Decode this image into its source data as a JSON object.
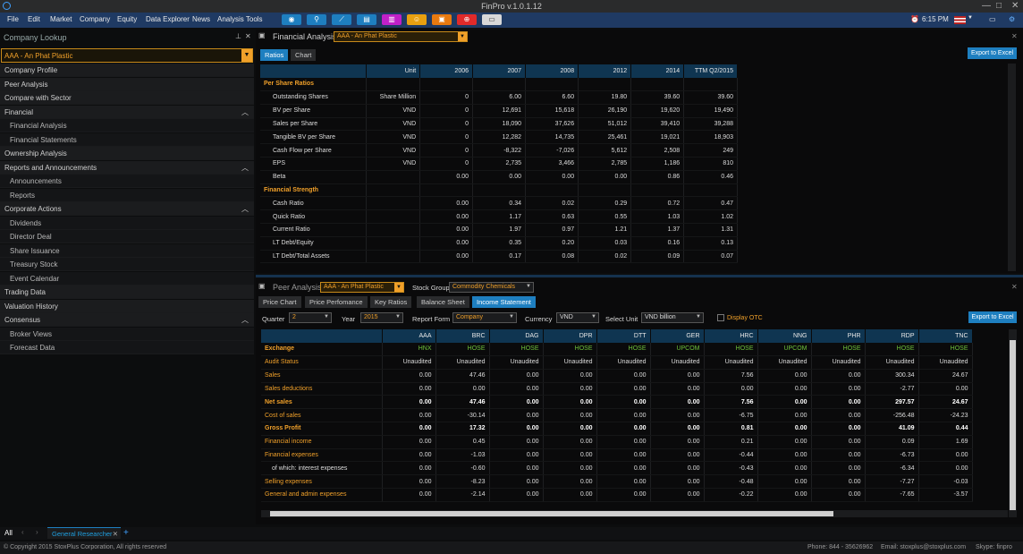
{
  "app": {
    "title": "FinPro v.1.0.1.12",
    "time": "6:15 PM"
  },
  "menu": [
    "File",
    "Edit",
    "Market",
    "Company",
    "Equity",
    "Data Explorer",
    "News",
    "Analysis Tools"
  ],
  "toolbar_colors": [
    "#1e7fc0",
    "#1e7fc0",
    "#1e7fc0",
    "#1e7fc0",
    "#c020c8",
    "#e8a010",
    "#e87a10",
    "#e02a2a",
    "#d8d8d8"
  ],
  "lookup": {
    "title": "Company Lookup",
    "selected": "AAA - An Phat Plastic"
  },
  "nav": [
    {
      "label": "Company Profile",
      "sub": false
    },
    {
      "label": "Peer Analysis",
      "sub": false
    },
    {
      "label": "Compare with Sector",
      "sub": false
    },
    {
      "label": "Financial",
      "sub": false,
      "exp": true
    },
    {
      "label": "Financial Analysis",
      "sub": true
    },
    {
      "label": "Financial Statements",
      "sub": true
    },
    {
      "label": "Ownership Analysis",
      "sub": false
    },
    {
      "label": "Reports and Announcements",
      "sub": false,
      "exp": true
    },
    {
      "label": "Announcements",
      "sub": true
    },
    {
      "label": "Reports",
      "sub": true
    },
    {
      "label": "Corporate Actions",
      "sub": false,
      "exp": true
    },
    {
      "label": "Dividends",
      "sub": true
    },
    {
      "label": "Director Deal",
      "sub": true
    },
    {
      "label": "Share Issuance",
      "sub": true
    },
    {
      "label": "Treasury Stock",
      "sub": true
    },
    {
      "label": "Event Calendar",
      "sub": true
    },
    {
      "label": "Trading Data",
      "sub": false
    },
    {
      "label": "Valuation History",
      "sub": false
    },
    {
      "label": "Consensus",
      "sub": false,
      "exp": true
    },
    {
      "label": "Broker Views",
      "sub": true
    },
    {
      "label": "Forecast Data",
      "sub": true
    }
  ],
  "fa": {
    "title": "Financial Analysis",
    "company": "AAA - An Phat Plastic",
    "tabs": [
      "Ratios",
      "Chart"
    ],
    "export": "Export to Excel",
    "headers": [
      "",
      "Unit",
      "2006",
      "2007",
      "2008",
      "2012",
      "2014",
      "TTM Q2/2015"
    ],
    "rows": [
      {
        "sec": true,
        "c": [
          "Per Share Ratios",
          "",
          "",
          "",
          "",
          "",
          "",
          ""
        ]
      },
      {
        "c": [
          "Outstanding Shares",
          "Share Million",
          "0",
          "6.00",
          "6.60",
          "19.80",
          "39.60",
          "39.60"
        ]
      },
      {
        "c": [
          "BV per Share",
          "VND",
          "0",
          "12,691",
          "15,618",
          "26,190",
          "19,620",
          "19,490"
        ]
      },
      {
        "c": [
          "Sales per Share",
          "VND",
          "0",
          "18,090",
          "37,626",
          "51,012",
          "39,410",
          "39,288"
        ]
      },
      {
        "c": [
          "Tangible BV per Share",
          "VND",
          "0",
          "12,282",
          "14,735",
          "25,461",
          "19,021",
          "18,903"
        ]
      },
      {
        "c": [
          "Cash Flow per Share",
          "VND",
          "0",
          "-8,322",
          "-7,026",
          "5,612",
          "2,508",
          "249"
        ]
      },
      {
        "c": [
          "EPS",
          "VND",
          "0",
          "2,735",
          "3,466",
          "2,785",
          "1,186",
          "810"
        ]
      },
      {
        "c": [
          "Beta",
          "",
          "0.00",
          "0.00",
          "0.00",
          "0.00",
          "0.86",
          "0.46"
        ]
      },
      {
        "sec": true,
        "c": [
          "Financial Strength",
          "",
          "",
          "",
          "",
          "",
          "",
          ""
        ]
      },
      {
        "c": [
          "Cash Ratio",
          "",
          "0.00",
          "0.34",
          "0.02",
          "0.29",
          "0.72",
          "0.47"
        ]
      },
      {
        "c": [
          "Quick Ratio",
          "",
          "0.00",
          "1.17",
          "0.63",
          "0.55",
          "1.03",
          "1.02"
        ]
      },
      {
        "c": [
          "Current Ratio",
          "",
          "0.00",
          "1.97",
          "0.97",
          "1.21",
          "1.37",
          "1.31"
        ]
      },
      {
        "c": [
          "LT Debt/Equity",
          "",
          "0.00",
          "0.35",
          "0.20",
          "0.03",
          "0.16",
          "0.13"
        ]
      },
      {
        "c": [
          "LT Debt/Total Assets",
          "",
          "0.00",
          "0.17",
          "0.08",
          "0.02",
          "0.09",
          "0.07"
        ]
      }
    ]
  },
  "pa": {
    "title": "Peer Analysis",
    "company": "AAA - An Phat Plastic",
    "stock_group_label": "Stock Group",
    "stock_group": "Commodity Chemicals",
    "tabs": [
      "Price Chart",
      "Price Perfomance",
      "Key Ratios",
      "Balance Sheet",
      "Income Statement"
    ],
    "filters": {
      "quarter_label": "Quarter",
      "quarter": "2",
      "year_label": "Year",
      "year": "2015",
      "report_label": "Report Form",
      "report": "Company",
      "currency_label": "Currency",
      "currency": "VND",
      "unit_label": "Select Unit",
      "unit": "VND billion",
      "display_otc": "Display OTC"
    },
    "export": "Export to Excel",
    "headers": [
      "",
      "AAA",
      "BRC",
      "DAG",
      "DPR",
      "DTT",
      "GER",
      "HRC",
      "NNG",
      "PHR",
      "RDP",
      "TNC"
    ],
    "rows": [
      {
        "t": "ex",
        "c": [
          "Exchange",
          "HNX",
          "HOSE",
          "HOSE",
          "HOSE",
          "HOSE",
          "UPCOM",
          "HOSE",
          "UPCOM",
          "HOSE",
          "HOSE",
          "HOSE"
        ]
      },
      {
        "c": [
          "Audit Status",
          "Unaudited",
          "Unaudited",
          "Unaudited",
          "Unaudited",
          "Unaudited",
          "Unaudited",
          "Unaudited",
          "Unaudited",
          "Unaudited",
          "Unaudited",
          "Unaudited"
        ]
      },
      {
        "c": [
          "Sales",
          "0.00",
          "47.46",
          "0.00",
          "0.00",
          "0.00",
          "0.00",
          "7.56",
          "0.00",
          "0.00",
          "300.34",
          "24.67"
        ]
      },
      {
        "c": [
          "Sales deductions",
          "0.00",
          "0.00",
          "0.00",
          "0.00",
          "0.00",
          "0.00",
          "0.00",
          "0.00",
          "0.00",
          "-2.77",
          "0.00"
        ]
      },
      {
        "t": "b",
        "c": [
          "Net sales",
          "0.00",
          "47.46",
          "0.00",
          "0.00",
          "0.00",
          "0.00",
          "7.56",
          "0.00",
          "0.00",
          "297.57",
          "24.67"
        ]
      },
      {
        "c": [
          "Cost of sales",
          "0.00",
          "-30.14",
          "0.00",
          "0.00",
          "0.00",
          "0.00",
          "-6.75",
          "0.00",
          "0.00",
          "-256.48",
          "-24.23"
        ]
      },
      {
        "t": "b",
        "c": [
          "Gross Profit",
          "0.00",
          "17.32",
          "0.00",
          "0.00",
          "0.00",
          "0.00",
          "0.81",
          "0.00",
          "0.00",
          "41.09",
          "0.44"
        ]
      },
      {
        "c": [
          "Financial income",
          "0.00",
          "0.45",
          "0.00",
          "0.00",
          "0.00",
          "0.00",
          "0.21",
          "0.00",
          "0.00",
          "0.09",
          "1.69"
        ]
      },
      {
        "c": [
          "Financial expenses",
          "0.00",
          "-1.03",
          "0.00",
          "0.00",
          "0.00",
          "0.00",
          "-0.44",
          "0.00",
          "0.00",
          "-6.73",
          "0.00"
        ]
      },
      {
        "t": "w",
        "c": [
          "of which: interest expenses",
          "0.00",
          "-0.60",
          "0.00",
          "0.00",
          "0.00",
          "0.00",
          "-0.43",
          "0.00",
          "0.00",
          "-6.34",
          "0.00"
        ]
      },
      {
        "c": [
          "Selling expenses",
          "0.00",
          "-8.23",
          "0.00",
          "0.00",
          "0.00",
          "0.00",
          "-0.48",
          "0.00",
          "0.00",
          "-7.27",
          "-0.03"
        ]
      },
      {
        "c": [
          "General and admin expenses",
          "0.00",
          "-2.14",
          "0.00",
          "0.00",
          "0.00",
          "0.00",
          "-0.22",
          "0.00",
          "0.00",
          "-7.65",
          "-3.57"
        ]
      }
    ]
  },
  "bottom": {
    "all": "All",
    "tab": "General Researcher",
    "plus": "+"
  },
  "footer": {
    "copyright": "© Copyright 2015 StoxPlus Corporation, All rights reserved",
    "phone": "Phone: 844 - 35626962",
    "email": "Email: stoxplus@stoxplus.com",
    "skype": "Skype: finpro"
  }
}
